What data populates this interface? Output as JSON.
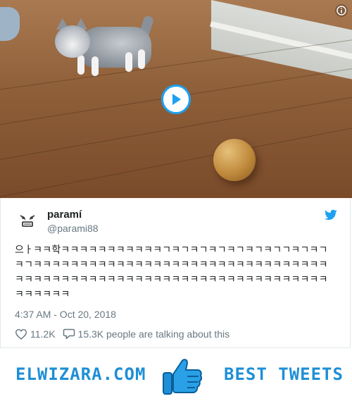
{
  "tweet": {
    "display_name": "paramí",
    "handle": "@parami88",
    "text": "으ㅏㅋㅋ학ㅋㅋㅋㅋㅋㅋㅋㅋㅋㅋㅋㄱㅋㄱㅋㄱㅋㄱㅋㄱㅋㄱㅋㄱㄱㅋㄱㅋㄱㅋㄱㅋㅋㅋㅋㅋㅋㅋㅋㅋㅋㅋㅋㅋㅋㅋㅋㅋㅋㅋㅋㅋㅋㅋㅋㅋㅋㅋㅋㅋㅋㅋㅋㅋㅋㅋㅋㅋㅋㅋㅋㅋㅋㅋㅋㅋㅋㅋㅋㅋㅋㅋㅋㅋㅋㅋㅋㅋㅋㅋㅋㅋㅋㅋㅋㅋㅋㅋㅋㅋㅋㅋㅋ",
    "timestamp": "4:37 AM - Oct 20, 2018",
    "likes": "11.2K",
    "talking": "15.3K people are talking about this"
  },
  "banner": {
    "left_text": "ELWIZARA.COM",
    "right_text": "BEST TWEETS"
  },
  "colors": {
    "accent": "#1da1f2",
    "banner_text": "#1e8fd6"
  },
  "icons": {
    "play": "play-icon",
    "info": "info-icon",
    "bird": "twitter-bird-icon",
    "heart": "heart-icon",
    "comment": "comment-bubble-icon",
    "thumbs": "thumbs-up-icon"
  }
}
